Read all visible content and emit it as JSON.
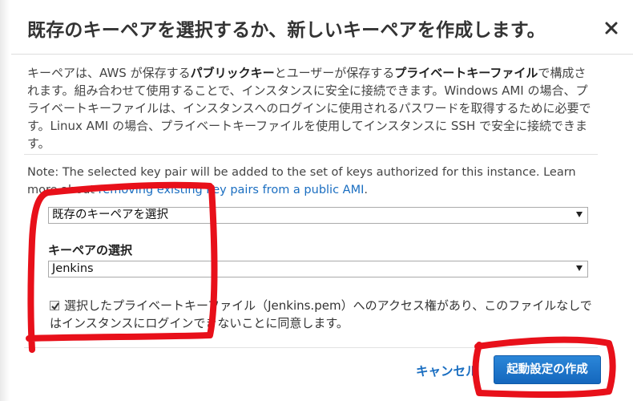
{
  "dialog": {
    "title": "既存のキーペアを選択するか、新しいキーペアを作成します。",
    "close_icon": "close-icon"
  },
  "description": {
    "part1": "キーペアは、AWS が保存する",
    "bold1": "パブリックキー",
    "part2": "とユーザーが保存する",
    "bold2": "プライベートキーファイル",
    "part3": "で構成されます。組み合わせて使用することで、インスタンスに安全に接続できます。Windows AMI の場合、プライベートキーファイルは、インスタンスへのログインに使用されるパスワードを取得するために必要です。Linux AMI の場合、プライベートキーファイルを使用してインスタンスに SSH で安全に接続できます。"
  },
  "note": {
    "text": "Note: The selected key pair will be added to the set of keys authorized for this instance. Learn more about ",
    "link": "removing existing key pairs from a public AMI",
    "end": "."
  },
  "key_option_select": {
    "value": "既存のキーペアを選択"
  },
  "key_pair": {
    "label": "キーペアの選択",
    "value": "Jenkins"
  },
  "acknowledge": {
    "checked": true,
    "text": "選択したプライベートキーファイル（Jenkins.pem）へのアクセス権があり、このファイルなしではインスタンスにログインできないことに同意します。"
  },
  "footer": {
    "cancel_label": "キャンセル",
    "create_label": "起動設定の作成"
  },
  "colors": {
    "link": "#1a6ec1",
    "primary": "#1a73cf",
    "annotation": "#e8101a"
  }
}
